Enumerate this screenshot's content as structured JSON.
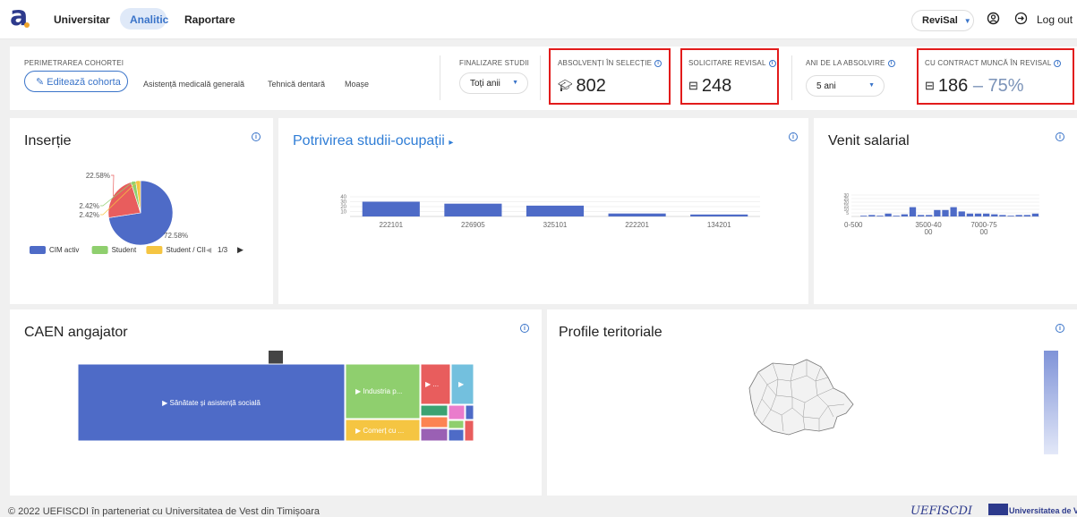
{
  "nav": {
    "logo": "a",
    "items": [
      {
        "label": "Universitar"
      },
      {
        "label": "Analitic"
      },
      {
        "label": "Raportare"
      }
    ],
    "revisal": "ReviSal",
    "logout": "Log out"
  },
  "filters": {
    "cohort_title": "PERIMETRAREA COHORTEI",
    "edit_label": "Editează cohorta",
    "chips": [
      "Asistență medicală generală",
      "Tehnică dentară",
      "Moașe"
    ],
    "finalizare_title": "FINALIZARE STUDII",
    "finalizare_value": "Toți anii",
    "absolventi_title": "ABSOLVENȚI ÎN SELECȚIE",
    "absolventi_value": "802",
    "solicitare_title": "SOLICITARE REVISAL",
    "solicitare_value": "248",
    "ani_title": "ANI DE LA ABSOLVIRE",
    "ani_value": "5 ani",
    "contract_title": "CU CONTRACT MUNCĂ ÎN REVISAL",
    "contract_value": "186",
    "contract_dash": " – ",
    "contract_pct": "75%"
  },
  "panels": {
    "insertie": "Inserție",
    "potrivire": "Potrivirea studii-ocupații",
    "potrivire_arrow": "▸",
    "venit": "Venit salarial",
    "caen": "CAEN angajator",
    "profile": "Profile teritoriale"
  },
  "info_glyph": "i",
  "chart_data": [
    {
      "type": "pie",
      "title": "Inserție",
      "labels": [
        "CIM activ",
        "Student",
        "Student / CII"
      ],
      "values": [
        72.58,
        22.58,
        2.42,
        2.42
      ],
      "value_labels": [
        "72.58%",
        "22.58%",
        "2.42%",
        "2.42%"
      ],
      "colors": [
        "#4e6bc7",
        "#e85d5d",
        "#8fcf6e",
        "#f5c542"
      ],
      "legend": [
        {
          "label": "CIM activ",
          "color": "#4e6bc7"
        },
        {
          "label": "Student",
          "color": "#8fcf6e"
        },
        {
          "label": "Student / CII",
          "color": "#f5c542"
        }
      ],
      "legend_page": "1/3",
      "legend_position": "bottom"
    },
    {
      "type": "bar",
      "title": "Potrivirea studii-ocupații",
      "categories": [
        "222101",
        "226905",
        "325101",
        "222201",
        "134201"
      ],
      "values": [
        30,
        26,
        22,
        6,
        4
      ],
      "y_ticks": [
        "40",
        "30",
        "20",
        "10"
      ],
      "ylim": [
        0,
        40
      ],
      "color": "#4e6bc7"
    },
    {
      "type": "bar",
      "title": "Venit salarial",
      "x_tick_labels": [
        "0-500",
        "3500-40\n00",
        "7000-75\n00"
      ],
      "y_ticks": [
        "30",
        "25",
        "20",
        "15",
        "10",
        "5"
      ],
      "values": [
        0,
        1,
        2,
        1,
        4,
        1,
        3,
        13,
        2,
        2,
        9,
        9,
        13,
        7,
        4,
        4,
        4,
        3,
        2,
        1,
        2,
        2,
        4
      ],
      "ylim": [
        0,
        30
      ],
      "color": "#4e6bc7"
    },
    {
      "type": "heatmap",
      "title": "CAEN angajator",
      "labels": [
        "▶ Sănătate și asistență socială",
        "▶ Industria p...",
        "▶ Comerț cu ...",
        "▶ ...",
        "▶"
      ],
      "colors": [
        "#4e6bc7",
        "#8fcf6e",
        "#f5c542",
        "#e85d5d",
        "#73c0de",
        "#3ba272",
        "#fc8452",
        "#9a60b4",
        "#ea7ccc"
      ]
    }
  ],
  "footer": {
    "copyright": "© 2022 UEFISCDI în parteneriat cu Universitatea de Vest din Timișoara",
    "logo1": "UEFISCDI",
    "logo2": "Universitatea de Vest"
  }
}
